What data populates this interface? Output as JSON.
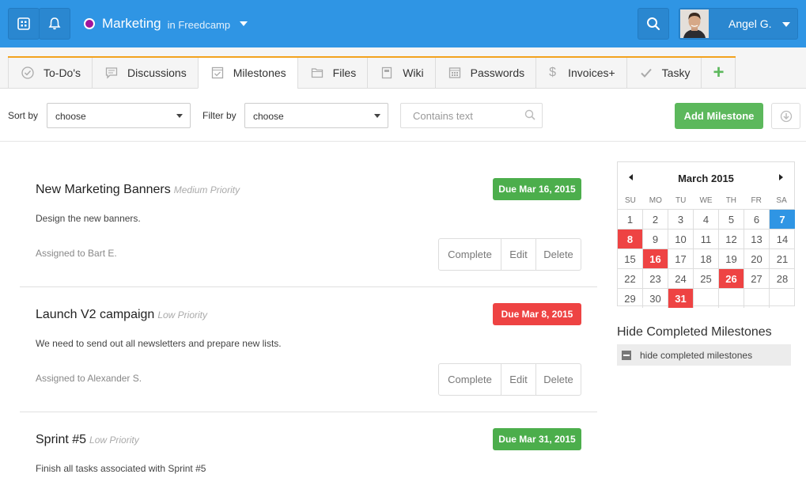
{
  "header": {
    "project_name": "Marketing",
    "project_sub": "in Freedcamp",
    "user_name": "Angel G."
  },
  "tabs": [
    {
      "label": "To-Do's",
      "icon": "checkmark-circle-icon"
    },
    {
      "label": "Discussions",
      "icon": "speech-bubble-icon"
    },
    {
      "label": "Milestones",
      "icon": "milestone-checkbox-icon",
      "active": true
    },
    {
      "label": "Files",
      "icon": "folder-icon"
    },
    {
      "label": "Wiki",
      "icon": "book-icon"
    },
    {
      "label": "Passwords",
      "icon": "keypad-icon"
    },
    {
      "label": "Invoices+",
      "icon": "dollar-icon"
    },
    {
      "label": "Tasky",
      "icon": "check-icon"
    },
    {
      "label": "+",
      "icon": "plus-icon"
    }
  ],
  "filters": {
    "sort_label": "Sort by",
    "sort_value": "choose",
    "filter_label": "Filter by",
    "filter_value": "choose",
    "search_placeholder": "Contains text",
    "add_button": "Add Milestone"
  },
  "milestones": [
    {
      "title": "New Marketing Banners",
      "priority": "Medium Priority",
      "description": "Design the new banners.",
      "assigned": "Assigned to Bart E.",
      "due": "Due Mar 16, 2015",
      "due_color": "#4cae4c"
    },
    {
      "title": "Launch V2 campaign",
      "priority": "Low Priority",
      "description": "We need to send out all newsletters and prepare new lists.",
      "assigned": "Assigned to Alexander S.",
      "due": "Due Mar 8, 2015",
      "due_color": "#ee4343"
    },
    {
      "title": "Sprint #5",
      "priority": "Low Priority",
      "description": "Finish all tasks associated with Sprint #5",
      "due": "Due Mar 31, 2015",
      "due_color": "#4cae4c"
    }
  ],
  "actions": {
    "complete": "Complete",
    "edit": "Edit",
    "delete": "Delete"
  },
  "calendar": {
    "month": "March 2015",
    "weekdays": [
      "SU",
      "MO",
      "TU",
      "WE",
      "TH",
      "FR",
      "SA"
    ],
    "days": [
      "1",
      "2",
      "3",
      "4",
      "5",
      "6",
      "7",
      "8",
      "9",
      "10",
      "11",
      "12",
      "13",
      "14",
      "15",
      "16",
      "17",
      "18",
      "19",
      "20",
      "21",
      "22",
      "23",
      "24",
      "25",
      "26",
      "27",
      "28",
      "29",
      "30",
      "31",
      "",
      "",
      "",
      ""
    ],
    "highlight_red": [
      "8",
      "16",
      "26",
      "31"
    ],
    "today": "7"
  },
  "hide_completed": {
    "heading": "Hide Completed Milestones",
    "toggle_label": "hide completed milestones"
  }
}
